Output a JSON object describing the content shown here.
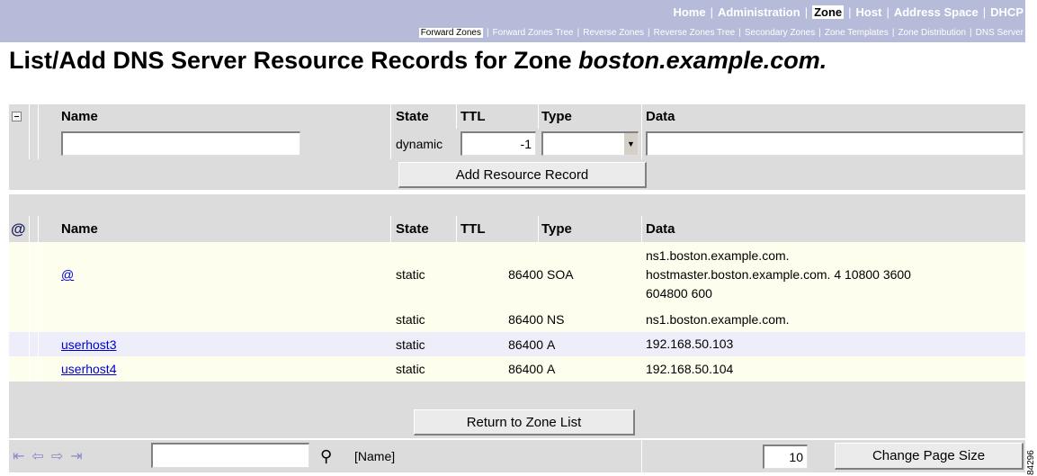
{
  "nav": {
    "main": [
      {
        "label": "Home",
        "active": false
      },
      {
        "label": "Administration",
        "active": false
      },
      {
        "label": "Zone",
        "active": true
      },
      {
        "label": "Host",
        "active": false
      },
      {
        "label": "Address Space",
        "active": false
      },
      {
        "label": "DHCP",
        "active": false
      }
    ],
    "sub": [
      {
        "label": "Forward Zones",
        "active": true
      },
      {
        "label": "Forward Zones Tree",
        "active": false
      },
      {
        "label": "Reverse Zones",
        "active": false
      },
      {
        "label": "Reverse Zones Tree",
        "active": false
      },
      {
        "label": "Secondary Zones",
        "active": false
      },
      {
        "label": "Zone Templates",
        "active": false
      },
      {
        "label": "Zone Distribution",
        "active": false
      },
      {
        "label": "DNS Server",
        "active": false
      }
    ]
  },
  "page": {
    "title_prefix": "List/Add DNS Server Resource Records for Zone",
    "zone_name": "boston.example.com."
  },
  "add_form": {
    "headers": {
      "name": "Name",
      "state": "State",
      "ttl": "TTL",
      "type": "Type",
      "data": "Data"
    },
    "name_value": "",
    "state_value": "dynamic",
    "ttl_value": "-1",
    "type_value": "",
    "data_value": "",
    "add_button": "Add Resource Record"
  },
  "records": {
    "headers": {
      "name": "Name",
      "state": "State",
      "ttl": "TTL",
      "type": "Type",
      "data": "Data"
    },
    "rows": [
      {
        "name": "@",
        "state": "static",
        "ttl": "86400",
        "type": "SOA",
        "data_lines": [
          "ns1.boston.example.com.",
          "hostmaster.boston.example.com. 4 10800 3600",
          "604800 600"
        ]
      },
      {
        "name": "",
        "state": "static",
        "ttl": "86400",
        "type": "NS",
        "data_lines": [
          "ns1.boston.example.com."
        ]
      },
      {
        "name": "userhost3",
        "state": "static",
        "ttl": "86400",
        "type": "A",
        "data_lines": [
          "192.168.50.103"
        ]
      },
      {
        "name": "userhost4",
        "state": "static",
        "ttl": "86400",
        "type": "A",
        "data_lines": [
          "192.168.50.104"
        ]
      }
    ]
  },
  "footer": {
    "return_button": "Return to Zone List",
    "search_value": "",
    "search_field_label": "[Name]",
    "page_size_value": "10",
    "change_page_size_button": "Change Page Size"
  },
  "side_tag": "84296",
  "colors": {
    "nav_bg": "#b5bbd9",
    "row_gray": "#dcdcdc",
    "row_yellow": "#fefeee",
    "row_lavender": "#eeeefa",
    "link": "#0000cc"
  }
}
